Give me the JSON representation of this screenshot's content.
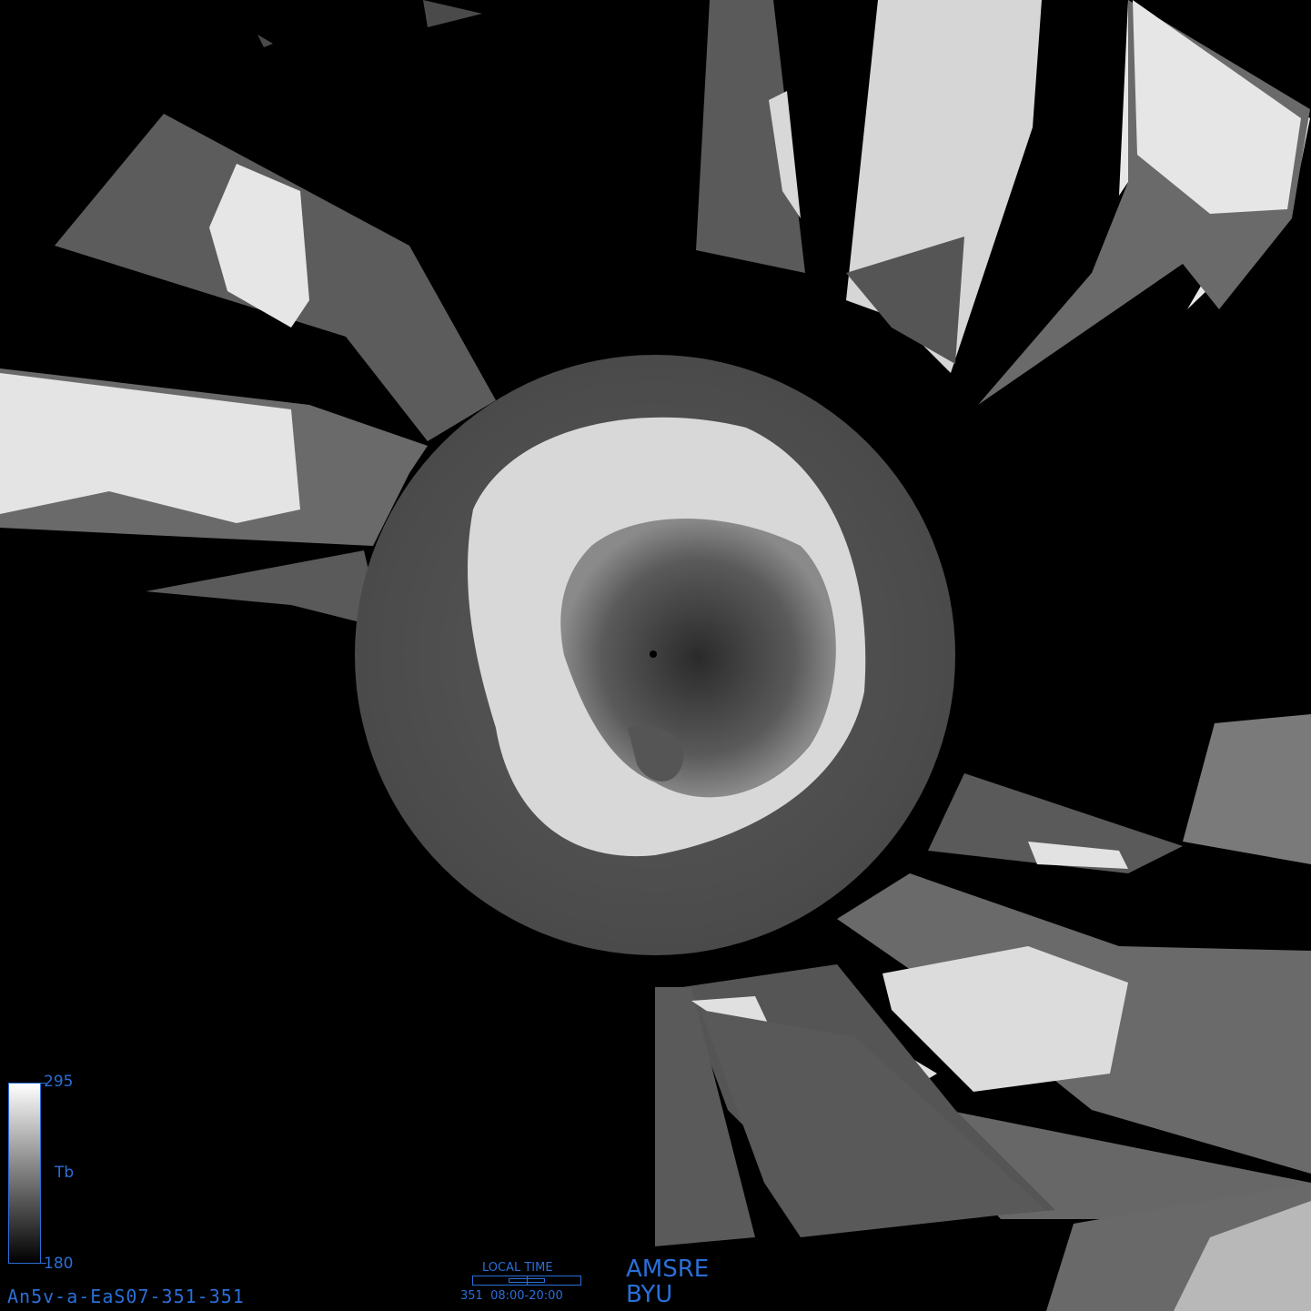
{
  "colorbar": {
    "max_label": "295",
    "mid_label": "Tb",
    "min_label": "180",
    "accent_color": "#2a6fd8"
  },
  "product_id": "An5v-a-EaS07-351-351",
  "local_time": {
    "title": "LOCAL TIME",
    "day": "351",
    "range": "08:00-20:00"
  },
  "sensor": "AMSRE",
  "organization": "BYU",
  "map": {
    "projection": "polar stereographic (south pole)",
    "center_feature": "Antarctica",
    "background_color": "#000000"
  }
}
